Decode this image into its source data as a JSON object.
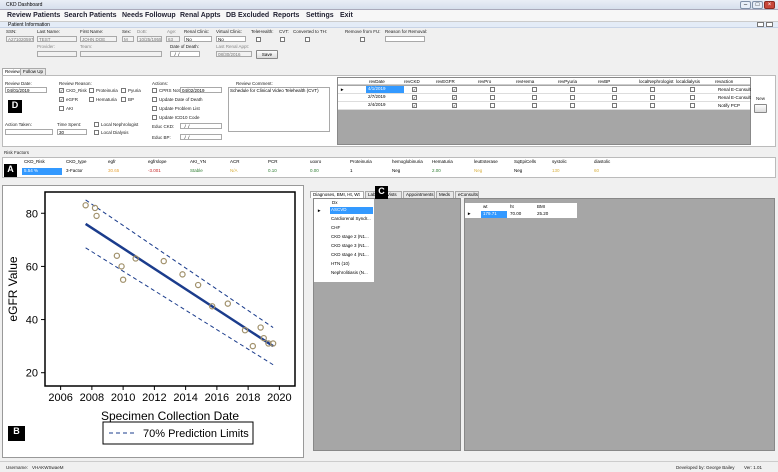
{
  "app": {
    "title": "CKD Dashboard"
  },
  "menu": [
    "Review Patients",
    "Search Patients",
    "Needs Followup",
    "Renal Appts",
    "DB Excluded",
    "Reports",
    "Settings",
    "Exit"
  ],
  "section": "Patient Information",
  "patient": {
    "ssn_label": "SSN:",
    "ssn": "A271020597",
    "last_label": "Last Name:",
    "last": "TEST",
    "first_label": "First Name:",
    "first": "JOHN DOE",
    "sex_label": "Sex:",
    "sex": "M",
    "dob_label": "DoB:",
    "dob": "10/25/1955",
    "age_label": "Age:",
    "age": "63",
    "renal_label": "Renal Clinic:",
    "renal": "No",
    "virtual_label": "Virtual Clinic:",
    "virtual": "No",
    "telehealth_label": "TeleHealth:",
    "cvt_label": "CVT:",
    "converted_label": "Converted to TH:",
    "remove_label": "Remove from FU:",
    "reason_label": "Reason for Removal:",
    "provider_label": "Provider:",
    "team_label": "Team:",
    "death_label": "Date of Death:",
    "death": "_/_/____",
    "lastrenal_label": "Last Renal Appt:",
    "lastrenal": "08/30/2016",
    "save": "Save"
  },
  "tabs": [
    "Review",
    "Follow Up"
  ],
  "review": {
    "date_label": "Review Date:",
    "date": "04/01/2019",
    "reason_label": "Review Reason:",
    "reasons": [
      "CKD_Risk",
      "Proteinuria",
      "Pyuria",
      "eGFR",
      "Hematuria",
      "BP",
      "AKI"
    ],
    "actions_label": "Actions:",
    "cprs_label": "CPRS Note:",
    "cprs": "04/02/2019",
    "act_items": [
      "Update Date of Death",
      "Update Problem List",
      "Update ICD10 Code"
    ],
    "educ_ckd_label": "Educ CKD:",
    "educ_ckd": "_/_/____",
    "educ_bp_label": "Educ BP:",
    "educ_bp": "_/_/____",
    "comment_label": "Review Comment:",
    "comment": "Schedule for Clinical Video Telehealth (CVT)",
    "taken_label": "Action Taken:",
    "time_label": "Time Spent:",
    "time": "30",
    "local_neph": "Local Nephrologist",
    "local_dial": "Local Dialysis",
    "new_btn": "New"
  },
  "rev_grid": {
    "headers": [
      "revDate",
      "revCKD",
      "revEGFR",
      "revPro",
      "revHema",
      "revPyuria",
      "revBP",
      "localNephrologist",
      "localdialysis",
      "revaction"
    ],
    "rows": [
      {
        "date": "4/1/2019",
        "action": "Renal E-Consult"
      },
      {
        "date": "2/7/2019",
        "action": "Renal E-Consult"
      },
      {
        "date": "2/4/2019",
        "action": "Notify PCP"
      }
    ]
  },
  "risk": {
    "label": "Risk Factors",
    "headers": [
      "CKD_Risk",
      "CKD_type",
      "egfr",
      "egfrslope",
      "AKI_YN",
      "ACR",
      "PCR",
      "uoxro",
      "Proteinuria",
      "hemoglobinuria",
      "Hematuria",
      "leuEsterase",
      "SqEpiCells",
      "systolic",
      "diastolic"
    ],
    "values": [
      "5.54 %",
      "3-Factor",
      "30.65",
      "-3.001",
      "Stable",
      "N/A",
      "0.10",
      "0.00",
      "1",
      "Neg",
      "2.00",
      "Neg",
      "Neg",
      "130",
      "60"
    ]
  },
  "markers": {
    "a": "A",
    "b": "B",
    "c": "C",
    "d": "D"
  },
  "chart_data": {
    "type": "scatter",
    "xlabel": "Specimen Collection Date",
    "ylabel": "eGFR Value",
    "xlim": [
      2005,
      2021
    ],
    "ylim": [
      15,
      88
    ],
    "xticks": [
      "2006",
      "2008",
      "2010",
      "2012",
      "2014",
      "2016",
      "2018",
      "2020"
    ],
    "yticks": [
      "20",
      "40",
      "60",
      "80"
    ],
    "points": [
      [
        2007.6,
        83
      ],
      [
        2008.2,
        82
      ],
      [
        2008.3,
        79
      ],
      [
        2009.6,
        64
      ],
      [
        2009.9,
        60
      ],
      [
        2010.0,
        55
      ],
      [
        2010.8,
        63
      ],
      [
        2012.6,
        62
      ],
      [
        2013.8,
        57
      ],
      [
        2014.8,
        53
      ],
      [
        2015.7,
        45
      ],
      [
        2016.7,
        46
      ],
      [
        2017.8,
        36
      ],
      [
        2018.3,
        30
      ],
      [
        2018.8,
        37
      ],
      [
        2019.0,
        33
      ],
      [
        2019.3,
        31
      ],
      [
        2019.6,
        31
      ]
    ],
    "fit": [
      [
        2007.6,
        76
      ],
      [
        2019.6,
        30
      ]
    ],
    "legend": "70% Prediction Limits"
  },
  "lower_tabs": [
    "Diagnoses, BMI, Ht, Wt",
    "Labs",
    "Vists",
    "Appointments",
    "Meds",
    "eConsults"
  ],
  "dx": {
    "header": "Dx",
    "items": [
      "ASCVD",
      "Cardiorenal Syndr...",
      "CHF",
      "CKD stage 2 (N1...",
      "CKD stage 3 (N1...",
      "CKD stage 4 (N1...",
      "HTN (10)",
      "Nephrolitiasis (N..."
    ]
  },
  "bmi": {
    "headers": [
      "wt",
      "ht",
      "BMI"
    ],
    "row": [
      "179.71",
      "70.00",
      "25.20"
    ]
  },
  "status": {
    "user": "Username:",
    "username": "VHAKWSwaeM",
    "dev": "Developed by: George Bailey",
    "ver": "Ver: 1.01"
  }
}
